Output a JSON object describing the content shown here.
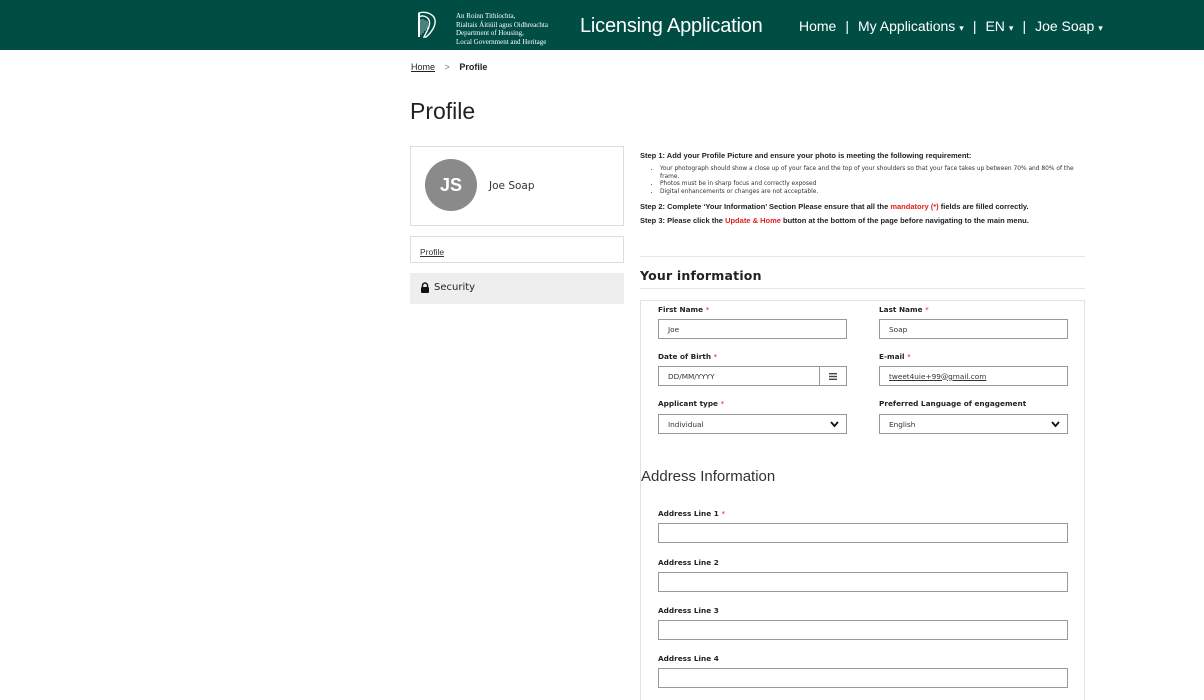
{
  "header": {
    "dept_lines": [
      "An Roinn Tithíochta,",
      "Rialtais Áitiúil agus Oidhreachta",
      "Department of Housing,",
      "Local Government and Heritage"
    ],
    "app_title": "Licensing Application",
    "nav": {
      "home": "Home",
      "sep": "|",
      "applications": "My Applications",
      "language": "EN",
      "user": "Joe Soap"
    },
    "bg_color": "#004d44"
  },
  "breadcrumb": {
    "home": "Home",
    "separator": ">",
    "current": "Profile"
  },
  "page_title": "Profile",
  "profile_card": {
    "initials": "JS",
    "name": "Joe Soap"
  },
  "sidebar": {
    "items": [
      {
        "label": "Profile"
      },
      {
        "label": "Security",
        "icon": "lock-icon"
      }
    ]
  },
  "instructions": {
    "step1": "Step 1: Add your Profile Picture and ensure your photo is meeting the following requirement:",
    "bullets": [
      "Your photograph should show a close up of your face and the top of your shoulders so that your face takes up between 70% and 80% of the frame.",
      "Photos must be in sharp focus and correctly exposed",
      "Digital enhancements or changes are not acceptable."
    ],
    "step2_prefix": "Step 2: Complete ‘Your Information’ Section Please ensure that all the",
    "step2_highlight": "mandatory (*)",
    "step2_suffix": "fields are filled correctly.",
    "step3_prefix": "Step 3: Please click the",
    "step3_highlight": "Update & Home",
    "step3_suffix": "button at the bottom of the page before navigating to the main menu."
  },
  "your_information": {
    "title": "Your information",
    "required_marker": "*",
    "first_name": {
      "label": "First Name",
      "value": "Joe"
    },
    "last_name": {
      "label": "Last Name",
      "value": "Soap"
    },
    "dob": {
      "label": "Date of Birth",
      "value": "DD/MM/YYYY"
    },
    "email": {
      "label": "E-mail",
      "value": "tweet4uie+99@gmail.com"
    },
    "applicant_type": {
      "label": "Applicant type",
      "value": "Individual"
    },
    "language": {
      "label": "Preferred Language of engagement",
      "value": "English"
    }
  },
  "address": {
    "title": "Address Information",
    "line1": {
      "label": "Address Line 1",
      "value": ""
    },
    "line2": {
      "label": "Address Line 2",
      "value": ""
    },
    "line3": {
      "label": "Address Line 3",
      "value": ""
    },
    "line4": {
      "label": "Address Line 4",
      "value": ""
    }
  },
  "colors": {
    "required": "#e0211c",
    "avatar_bg": "#8a8a8a",
    "sidebar_active_bg": "#eeeeee"
  }
}
